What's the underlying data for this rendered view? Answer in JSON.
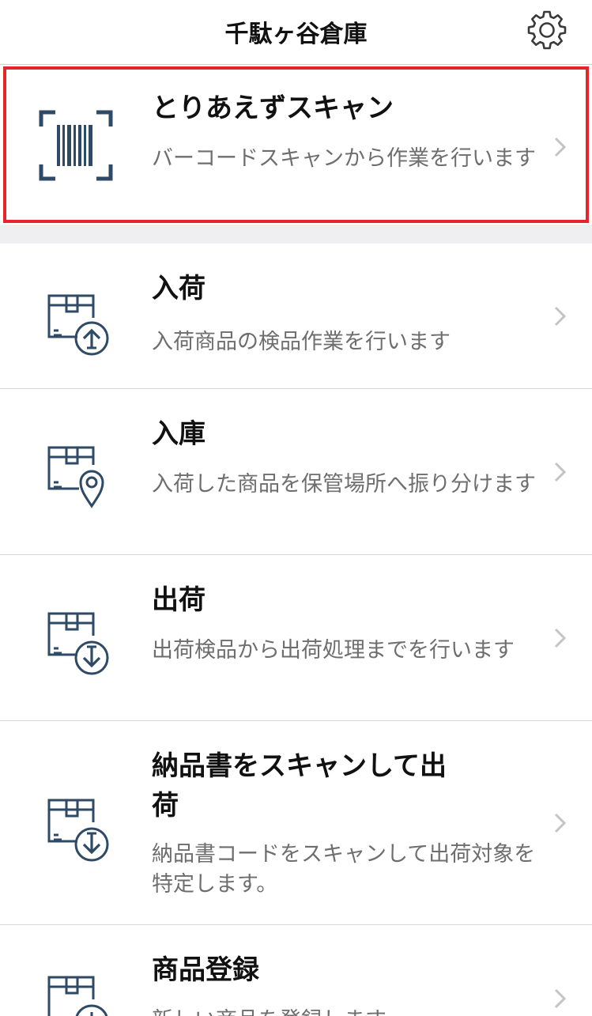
{
  "header": {
    "title": "千駄ヶ谷倉庫",
    "settings_icon": "gear-icon"
  },
  "menu": [
    {
      "icon": "barcode-scan-icon",
      "title": "とりあえずスキャン",
      "description": "バーコードスキャンから作業を行います"
    },
    {
      "icon": "box-inbound-icon",
      "title": "入荷",
      "description": "入荷商品の検品作業を行います"
    },
    {
      "icon": "box-location-icon",
      "title": "入庫",
      "description": "入荷した商品を保管場所へ振り分けます"
    },
    {
      "icon": "box-outbound-icon",
      "title": "出荷",
      "description": "出荷検品から出荷処理までを行います"
    },
    {
      "icon": "box-outbound-icon",
      "title": "納品書をスキャンして出荷",
      "description": "納品書コードをスキャンして出荷対象を特定します。"
    },
    {
      "icon": "box-register-icon",
      "title": "商品登録",
      "description": "新しい商品を登録します"
    }
  ],
  "colors": {
    "icon": "#2e4a66",
    "highlight": "#e5252c",
    "description_text": "#6e6e6e"
  }
}
